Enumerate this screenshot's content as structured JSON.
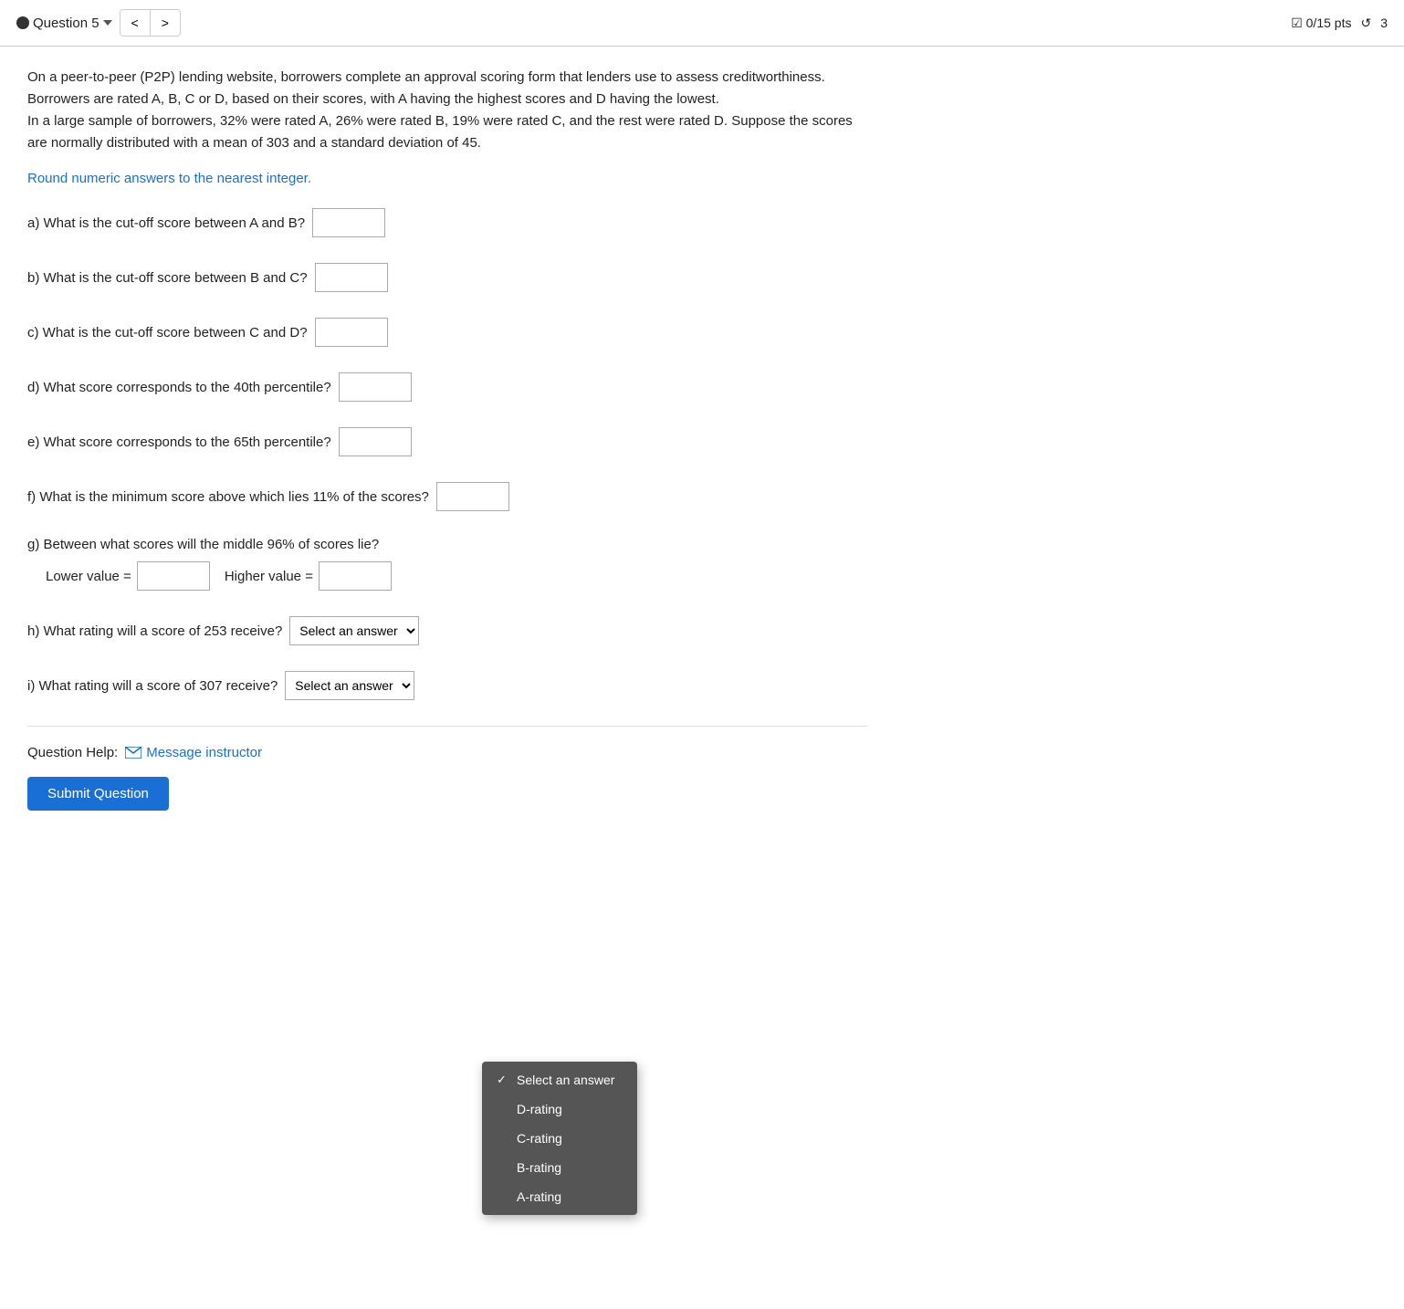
{
  "topbar": {
    "question_label": "Question 5",
    "prev_arrow": "<",
    "next_arrow": ">",
    "score": "0/15 pts",
    "attempts_icon": "↺",
    "attempts": "3"
  },
  "problem": {
    "description": "On a peer-to-peer (P2P) lending website, borrowers complete an approval scoring form that lenders use to assess creditworthiness. Borrowers are rated A, B, C or D, based on their scores, with A having the highest scores and D having the lowest.\nIn a large sample of borrowers, 32% were rated A, 26% were rated B, 19% were rated C, and the rest were rated D. Suppose the scores are normally distributed with a mean of 303 and a standard deviation of 45.",
    "round_note": "Round numeric answers to the nearest integer.",
    "parts": {
      "a": "a) What is the cut-off score between A and B?",
      "b": "b) What is the cut-off score between B and C?",
      "c": "c) What is the cut-off score between C and D?",
      "d": "d) What score corresponds to the 40th percentile?",
      "e": "e) What score corresponds to the 65th percentile?",
      "f": "f) What is the minimum score above which lies 11% of the scores?",
      "g": "g) Between what scores will the middle 96% of scores lie?",
      "g_lower": "Lower value =",
      "g_higher": "Higher value =",
      "h": "h) What rating will a score of 253 receive?",
      "i": "i) What rating will a score of 307 receive?"
    },
    "select_placeholder": "Select an answer",
    "dropdown_items": [
      {
        "label": "Select an answer",
        "selected": true
      },
      {
        "label": "D-rating",
        "selected": false
      },
      {
        "label": "C-rating",
        "selected": false
      },
      {
        "label": "B-rating",
        "selected": false
      },
      {
        "label": "A-rating",
        "selected": false
      }
    ]
  },
  "help": {
    "label": "Question Help:",
    "message_label": "Message instructor"
  },
  "submit": {
    "label": "Submit Question"
  }
}
